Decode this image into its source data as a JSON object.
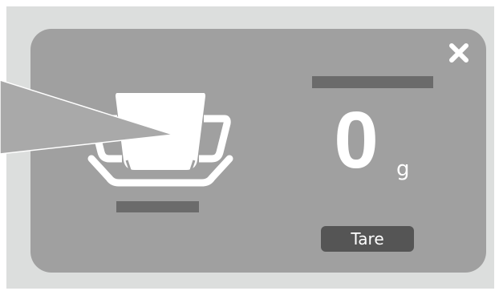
{
  "scale": {
    "weight_value": "0",
    "weight_unit": "g",
    "tare_label": "Tare"
  },
  "icons": {
    "close": "close-icon",
    "cup": "cup-icon",
    "pointer": "pointer-beam"
  },
  "colors": {
    "background": "#dcdedd",
    "panel": "#a0a0a0",
    "placeholder_bar": "#6b6b6b",
    "tare_button": "#555555",
    "foreground": "#ffffff"
  }
}
